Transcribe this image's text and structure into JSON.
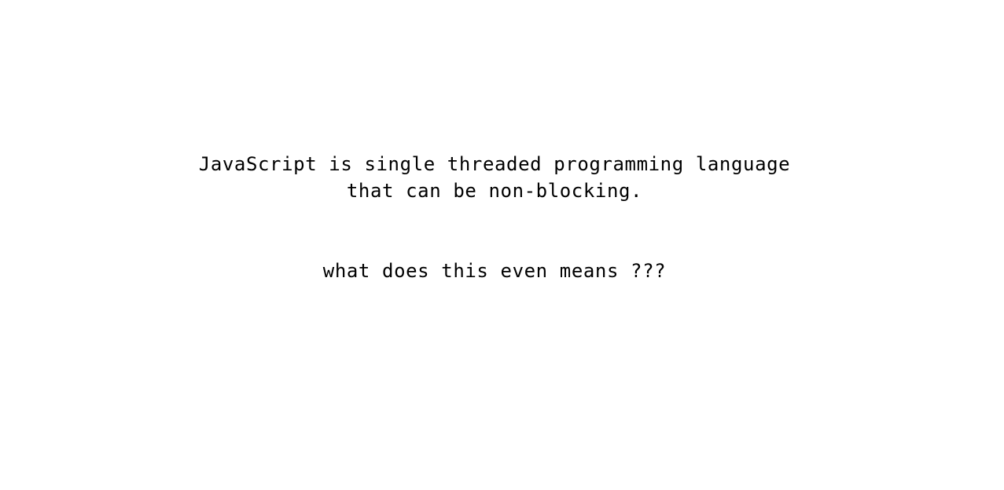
{
  "statement": {
    "line1": "JavaScript is single threaded programming language",
    "line2": "that can be non-blocking."
  },
  "question": "what does this even means ???"
}
